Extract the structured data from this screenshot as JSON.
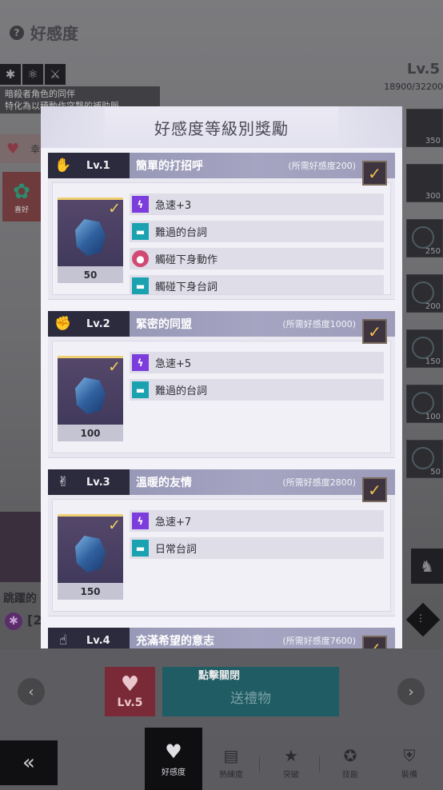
{
  "background": {
    "title": "好感度",
    "desc_line1": "暗殺者角色的同伴",
    "desc_line2": "特化為以積動作突擊的補助脈..",
    "level": "Lv.5",
    "exp": "18900/32200",
    "flower_label": "喜好",
    "heart_glyph": "幸",
    "side_slots": [
      {
        "num": "350"
      },
      {
        "num": "300"
      },
      {
        "num": "250"
      },
      {
        "num": "200"
      },
      {
        "num": "150"
      },
      {
        "num": "100"
      },
      {
        "num": "50"
      }
    ],
    "jump_text": "跳躍的",
    "purple_text": "[2",
    "badge_level": "Lv.5",
    "close_hint": "點擊關閉",
    "gift_button": "送禮物",
    "nav": {
      "affection": "好感度",
      "proficiency": "熟練度",
      "breakthrough": "突破",
      "skills": "技能",
      "equipment": "裝備"
    }
  },
  "modal": {
    "title": "好感度等級別獎勵",
    "levels": [
      {
        "lv": "Lv.1",
        "name": "簡單的打招呼",
        "requirement": "(所需好感度200)",
        "count": "50",
        "rewards": [
          {
            "icon": "haste-icon",
            "text": "急速+3"
          },
          {
            "icon": "chat-icon",
            "text": "難過的台詞"
          },
          {
            "icon": "person-icon",
            "text": "觸碰下身動作"
          },
          {
            "icon": "chat-icon",
            "text": "觸碰下身台詞"
          }
        ]
      },
      {
        "lv": "Lv.2",
        "name": "緊密的同盟",
        "requirement": "(所需好感度1000)",
        "count": "100",
        "rewards": [
          {
            "icon": "haste-icon",
            "text": "急速+5"
          },
          {
            "icon": "chat-icon",
            "text": "難過的台詞"
          }
        ]
      },
      {
        "lv": "Lv.3",
        "name": "溫暖的友情",
        "requirement": "(所需好感度2800)",
        "count": "150",
        "rewards": [
          {
            "icon": "haste-icon",
            "text": "急速+7"
          },
          {
            "icon": "chat-icon",
            "text": "日常台詞"
          }
        ]
      },
      {
        "lv": "Lv.4",
        "name": "充滿希望的意志",
        "requirement": "(所需好感度7600)"
      }
    ]
  }
}
